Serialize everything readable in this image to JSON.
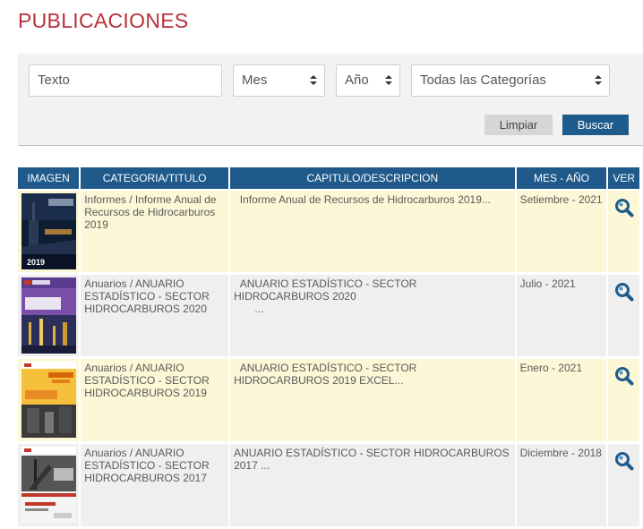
{
  "page": {
    "title": "PUBLICACIONES"
  },
  "filters": {
    "text_placeholder": "Texto",
    "month_select": "Mes",
    "year_select": "Año",
    "category_select": "Todas las Categorías",
    "clear_label": "Limpiar",
    "search_label": "Buscar"
  },
  "table": {
    "headers": [
      "IMAGEN",
      "CATEGORIA/TITULO",
      "CAPITULO/DESCRIPCION",
      "MES - AÑO",
      "VER"
    ],
    "rows": [
      {
        "title": "Informes / Informe Anual de Recursos de Hidrocarburos 2019",
        "description": "Informe Anual de Recursos de Hidrocarburos 2019...",
        "date": "Setiembre - 2021",
        "cover_year": "2019"
      },
      {
        "title": "Anuarios / ANUARIO ESTADÍSTICO - SECTOR HIDROCARBUROS 2020",
        "description": "ANUARIO ESTADÍSTICO - SECTOR HIDROCARBUROS 2020",
        "description_more": "...",
        "date": "Julio - 2021"
      },
      {
        "title": "Anuarios / ANUARIO ESTADÍSTICO - SECTOR HIDROCARBUROS 2019",
        "description": "ANUARIO ESTADÍSTICO - SECTOR HIDROCARBUROS 2019 EXCEL...",
        "date": "Enero - 2021"
      },
      {
        "title": "Anuarios / ANUARIO ESTADÍSTICO - SECTOR HIDROCARBUROS 2017",
        "description": "ANUARIO ESTADÍSTICO - SECTOR HIDROCARBUROS 2017 ...",
        "date": "Diciembre - 2018"
      }
    ]
  },
  "colors": {
    "title_red": "#b8313a",
    "header_blue": "#1f5a8b",
    "row_yellow": "#fcf7d6",
    "row_gray": "#efefef",
    "search_button": "#1e5b8a"
  },
  "icons": {
    "view": "magnifier-icon"
  }
}
